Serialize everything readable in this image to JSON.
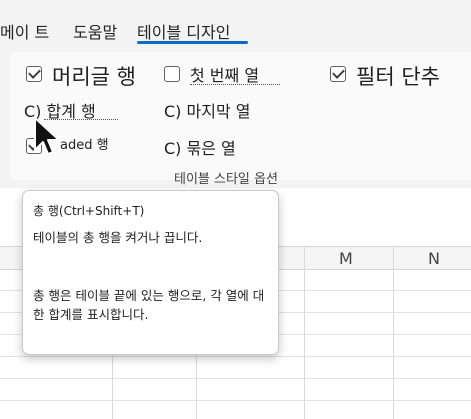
{
  "tabs": [
    {
      "label": "메이 트"
    },
    {
      "label": "도움말"
    },
    {
      "label": "테이블 디자인"
    }
  ],
  "options": {
    "header_row": {
      "label": "머리글 행",
      "checked": true
    },
    "first_column": {
      "label": "첫 번째 열",
      "checked": false
    },
    "filter_button": {
      "label": "필터 단추",
      "checked": true
    },
    "total_row": {
      "label": "C) 합계 행"
    },
    "last_column": {
      "label": "C) 마지막 열"
    },
    "banded_rows": {
      "label": "aded 행",
      "checked": true
    },
    "banded_columns": {
      "label": "C) 묶은 열"
    }
  },
  "group_label": "테이블 스타일 옵션",
  "tooltip": {
    "title": "총 행(Ctrl+Shift+T)",
    "line1": "테이블의 총 행을 켜거나 끕니다.",
    "line2": "총 행은 테이블 끝에 있는 행으로, 각 열에 대한 합계를 표시합니다."
  },
  "columns": [
    "M",
    "N"
  ],
  "colors": {
    "accent": "#0f6cbd"
  }
}
